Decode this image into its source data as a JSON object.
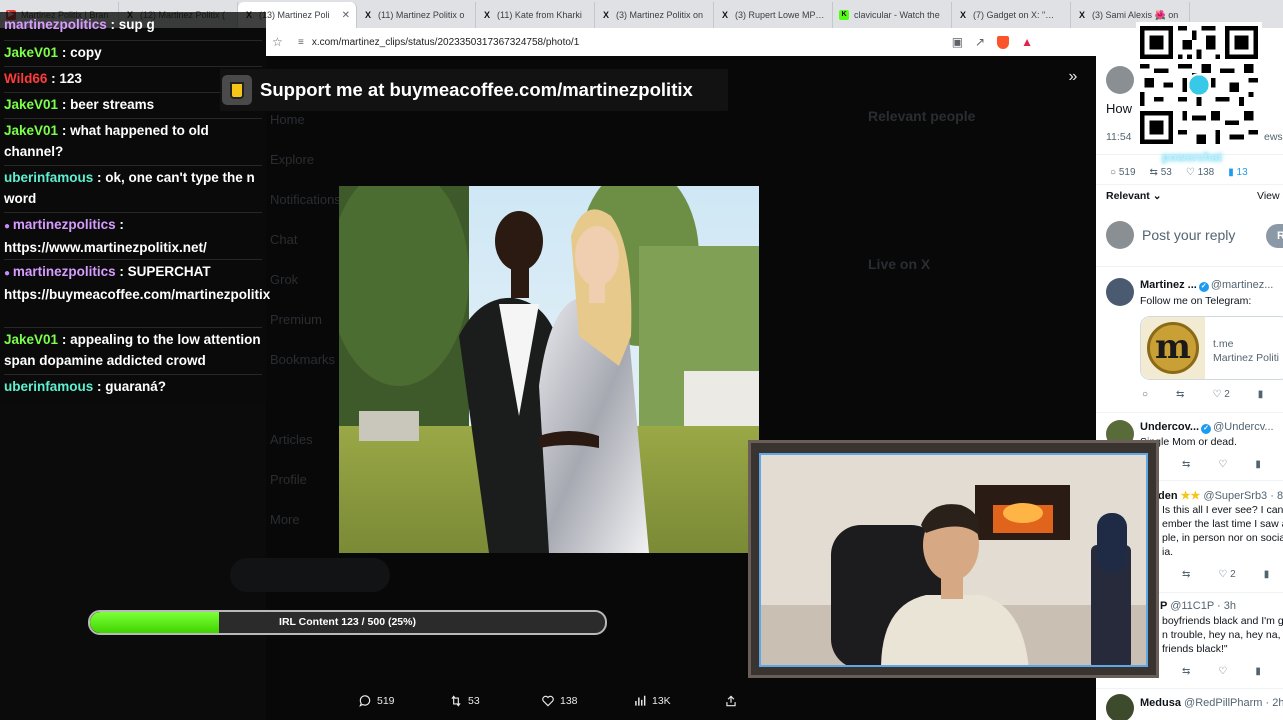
{
  "tabs": [
    {
      "label": "Martinez Politix | Bran",
      "icon": "youtube-icon",
      "active": false
    },
    {
      "label": "(12) Martinez Politix (",
      "icon": "x-logo-icon",
      "active": false
    },
    {
      "label": "(13) Martinez Poli",
      "icon": "x-logo-icon",
      "active": true
    },
    {
      "label": "(11) Martinez Politix o",
      "icon": "x-logo-icon",
      "active": false
    },
    {
      "label": "(11) Kate from Kharki",
      "icon": "x-logo-icon",
      "active": false
    },
    {
      "label": "(3) Martinez Politix on",
      "icon": "x-logo-icon",
      "active": false
    },
    {
      "label": "(3) Rupert Lowe MP on",
      "icon": "x-logo-icon",
      "active": false
    },
    {
      "label": "clavicular - Watch the",
      "icon": "kick-icon",
      "active": false
    },
    {
      "label": "(7) Gadget on X: \"📍📍",
      "icon": "x-logo-icon",
      "active": false
    },
    {
      "label": "(3) Sami Alexis 🌺 on",
      "icon": "x-logo-icon",
      "active": false
    }
  ],
  "address": {
    "url": "x.com/martinez_clips/status/2023350317367324758/photo/1"
  },
  "chat": [
    {
      "user": "martinezpolitics",
      "color": "#d79cff",
      "text": "sup g",
      "mod": false
    },
    {
      "user": "JakeV01",
      "color": "#7cff4a",
      "text": "copy",
      "mod": false
    },
    {
      "user": "Wild66",
      "color": "#ff3b3b",
      "text": "123",
      "mod": false
    },
    {
      "user": "JakeV01",
      "color": "#7cff4a",
      "text": "beer streams",
      "mod": false
    },
    {
      "user": "JakeV01",
      "color": "#7cff4a",
      "text": "what happened to old channel?",
      "mod": false
    },
    {
      "user": "uberinfamous",
      "color": "#5ef0d0",
      "text": "ok, one can't type the n word",
      "mod": false
    },
    {
      "user": "martinezpolitics",
      "color": "#d79cff",
      "text": "https://www.martinezpolitix.net/",
      "mod": true
    },
    {
      "user": "martinezpolitics",
      "color": "#d79cff",
      "text": "SUPERCHAT https://buymeacoffee.com/martinezpolitix",
      "mod": true
    },
    {
      "user": "JakeV01",
      "color": "#7cff4a",
      "text": "appealing to the low attention span dopamine addicted crowd",
      "mod": false
    },
    {
      "user": "uberinfamous",
      "color": "#5ef0d0",
      "text": "guaraná?",
      "mod": false
    }
  ],
  "support": {
    "text": "Support me at buymeacoffee.com/martinezpolitix"
  },
  "progress": {
    "label": "IRL Content 123 / 500 (25%)",
    "value": 123,
    "max": 500,
    "fraction": 0.25
  },
  "post_actions": {
    "replies": "519",
    "reposts": "53",
    "likes": "138",
    "views": "13K"
  },
  "right_pane": {
    "top_partial": "How",
    "time_partial": "11:54",
    "views_partial": "ews",
    "top_stats": {
      "replies": "519",
      "reposts": "53",
      "likes": "138",
      "bookmarks": "13"
    },
    "sort": "Relevant",
    "view_partial": "View ac",
    "reply_placeholder": "Post your reply",
    "reply_button": "R",
    "qr_overlay": "powerchat",
    "posts": [
      {
        "name": "Martinez ...",
        "handle": "@martinez...",
        "text": [
          "Follow me on Telegram:"
        ],
        "card_domain": "t.me",
        "card_title": "Martinez Politi",
        "card_letter": "m",
        "likes": "2"
      },
      {
        "name": "Undercov...",
        "handle": "@Undercv...",
        "text": [
          "Single Mom or dead."
        ]
      },
      {
        "name": "den",
        "handle": "@SuperSrb3 · 8",
        "text": [
          "Is this all I ever see? I can",
          "ember the last time I saw a",
          "ple, in person nor on social",
          "ia."
        ],
        "likes": "2"
      },
      {
        "name": "P",
        "handle": "@11C1P · 3h",
        "text": [
          "boyfriends black and I'm g",
          "n trouble, hey na, hey na, I",
          "friends black!\""
        ]
      },
      {
        "name": "Medusa",
        "handle": "@RedPillPharm · 2h",
        "text": []
      }
    ]
  }
}
